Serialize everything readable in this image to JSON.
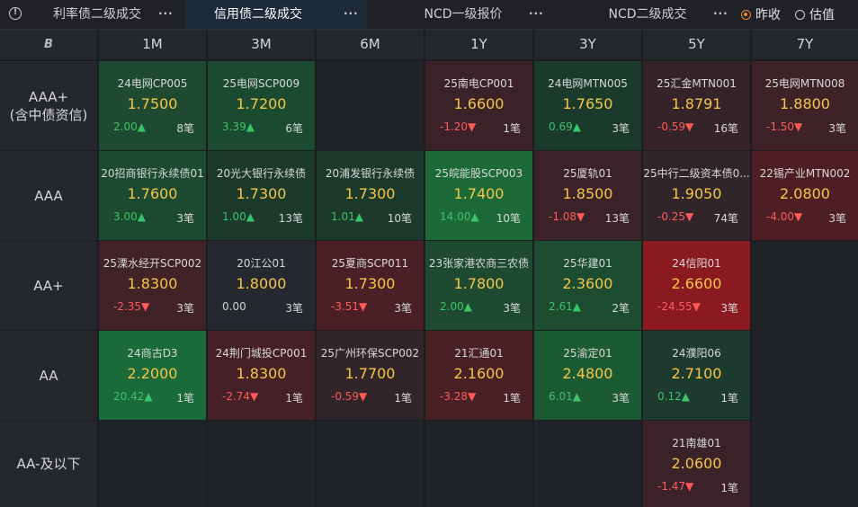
{
  "topbar": {
    "tabs": [
      {
        "label": "利率债二级成交",
        "active": false
      },
      {
        "label": "信用债二级成交",
        "active": true
      },
      {
        "label": "NCD一级报价",
        "active": false
      },
      {
        "label": "NCD二级成交",
        "active": false
      }
    ],
    "radios": [
      {
        "label": "昨收",
        "checked": true
      },
      {
        "label": "估值",
        "checked": false
      }
    ]
  },
  "grid": {
    "logo_text": "B",
    "columns": [
      "1M",
      "3M",
      "6M",
      "1Y",
      "3Y",
      "5Y",
      "7Y"
    ],
    "rows": [
      {
        "label_line1": "AAA+",
        "label_line2": "(含中债资信)",
        "cells": [
          {
            "name": "24电网CP005",
            "price": "1.7500",
            "change": "2.00▲",
            "count": "8笔",
            "dir": "up",
            "color": "#1d4a30"
          },
          {
            "name": "25电网SCP009",
            "price": "1.7200",
            "change": "3.39▲",
            "count": "6笔",
            "dir": "up",
            "color": "#1a4a30"
          },
          null,
          {
            "name": "25南电CP001",
            "price": "1.6600",
            "change": "-1.20▼",
            "count": "1笔",
            "dir": "dn",
            "color": "#3b2228"
          },
          {
            "name": "24电网MTN005",
            "price": "1.7650",
            "change": "0.69▲",
            "count": "3笔",
            "dir": "up",
            "color": "#1a3b2c"
          },
          {
            "name": "25汇金MTN001",
            "price": "1.8791",
            "change": "-0.59▼",
            "count": "16笔",
            "dir": "dn",
            "color": "#35232a"
          },
          {
            "name": "25电网MTN008",
            "price": "1.8800",
            "change": "-1.50▼",
            "count": "3笔",
            "dir": "dn",
            "color": "#3e2228"
          }
        ]
      },
      {
        "label_line1": "AAA",
        "label_line2": "",
        "cells": [
          {
            "name": "20招商银行永续债01",
            "price": "1.7600",
            "change": "3.00▲",
            "count": "3笔",
            "dir": "up",
            "color": "#1c4a30"
          },
          {
            "name": "20光大银行永续债",
            "price": "1.7300",
            "change": "1.00▲",
            "count": "13笔",
            "dir": "up",
            "color": "#1b3a2c"
          },
          {
            "name": "20浦发银行永续债",
            "price": "1.7300",
            "change": "1.01▲",
            "count": "10笔",
            "dir": "up",
            "color": "#1b3a2c"
          },
          {
            "name": "25皖能股SCP003",
            "price": "1.7400",
            "change": "14.00▲",
            "count": "10笔",
            "dir": "up",
            "color": "#1c6a38"
          },
          {
            "name": "25厦轨01",
            "price": "1.8500",
            "change": "-1.08▼",
            "count": "13笔",
            "dir": "dn",
            "color": "#3a2228"
          },
          {
            "name": "25中行二级资本债0...",
            "price": "1.9050",
            "change": "-0.25▼",
            "count": "74笔",
            "dir": "dn",
            "color": "#302529"
          },
          {
            "name": "22锡产业MTN002",
            "price": "2.0800",
            "change": "-4.00▼",
            "count": "3笔",
            "dir": "dn",
            "color": "#4d1f25"
          }
        ]
      },
      {
        "label_line1": "AA+",
        "label_line2": "",
        "cells": [
          {
            "name": "25溧水经开SCP002",
            "price": "1.8300",
            "change": "-2.35▼",
            "count": "3笔",
            "dir": "dn",
            "color": "#412226"
          },
          {
            "name": "20江公01",
            "price": "1.8000",
            "change": "0.00",
            "count": "3笔",
            "dir": "flat",
            "color": "#25292f"
          },
          {
            "name": "25夏商SCP011",
            "price": "1.7300",
            "change": "-3.51▼",
            "count": "3笔",
            "dir": "dn",
            "color": "#4a2026"
          },
          {
            "name": "23张家港农商三农债",
            "price": "1.7800",
            "change": "2.00▲",
            "count": "3笔",
            "dir": "up",
            "color": "#1d4a30"
          },
          {
            "name": "25华建01",
            "price": "2.3600",
            "change": "2.61▲",
            "count": "2笔",
            "dir": "up",
            "color": "#1c4d31"
          },
          {
            "name": "24信阳01",
            "price": "2.6600",
            "change": "-24.55▼",
            "count": "3笔",
            "dir": "dn",
            "color": "#8a1a20"
          },
          null
        ]
      },
      {
        "label_line1": "AA",
        "label_line2": "",
        "cells": [
          {
            "name": "24商古D3",
            "price": "2.2000",
            "change": "20.42▲",
            "count": "1笔",
            "dir": "up",
            "color": "#1b6a3a"
          },
          {
            "name": "24荆门城投CP001",
            "price": "1.8300",
            "change": "-2.74▼",
            "count": "1笔",
            "dir": "dn",
            "color": "#452026"
          },
          {
            "name": "25广州环保SCP002",
            "price": "1.7700",
            "change": "-0.59▼",
            "count": "1笔",
            "dir": "dn",
            "color": "#32252a"
          },
          {
            "name": "21汇通01",
            "price": "2.1600",
            "change": "-3.28▼",
            "count": "1笔",
            "dir": "dn",
            "color": "#482026"
          },
          {
            "name": "25渝定01",
            "price": "2.4800",
            "change": "6.01▲",
            "count": "3笔",
            "dir": "up",
            "color": "#1c5a34"
          },
          {
            "name": "24濮阳06",
            "price": "2.7100",
            "change": "0.12▲",
            "count": "1笔",
            "dir": "up",
            "color": "#1d3a2e"
          },
          null
        ]
      },
      {
        "label_line1": "AA-及以下",
        "label_line2": "",
        "cells": [
          null,
          null,
          null,
          null,
          null,
          {
            "name": "21南雄01",
            "price": "2.0600",
            "change": "-1.47▼",
            "count": "1笔",
            "dir": "dn",
            "color": "#3b2228"
          },
          null
        ]
      }
    ]
  }
}
